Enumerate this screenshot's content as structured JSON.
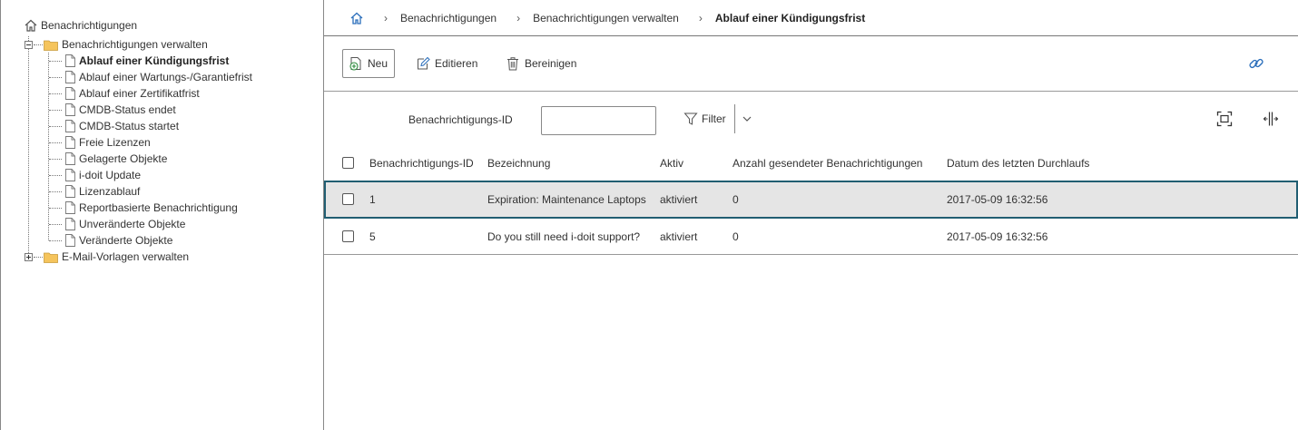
{
  "tree": {
    "root_label": "Benachrichtigungen",
    "group1_label": "Benachrichtigungen verwalten",
    "items": [
      "Ablauf einer Kündigungsfrist",
      "Ablauf einer Wartungs-/Garantiefrist",
      "Ablauf einer Zertifikatfrist",
      "CMDB-Status endet",
      "CMDB-Status startet",
      "Freie Lizenzen",
      "Gelagerte Objekte",
      "i-doit Update",
      "Lizenzablauf",
      "Reportbasierte Benachrichtigung",
      "Unveränderte Objekte",
      "Veränderte Objekte"
    ],
    "selected_item": "Ablauf einer Kündigungsfrist",
    "group2_label": "E-Mail-Vorlagen verwalten"
  },
  "breadcrumb": {
    "items": [
      "Benachrichtigungen",
      "Benachrichtigungen verwalten",
      "Ablauf einer Kündigungsfrist"
    ]
  },
  "toolbar": {
    "new_label": "Neu",
    "edit_label": "Editieren",
    "clean_label": "Bereinigen"
  },
  "filter": {
    "field_label": "Benachrichtigungs-ID",
    "input_value": "",
    "button_label": "Filter"
  },
  "table": {
    "columns": [
      "Benachrichtigungs-ID",
      "Bezeichnung",
      "Aktiv",
      "Anzahl gesendeter Benachrichtigungen",
      "Datum des letzten Durchlaufs"
    ],
    "rows": [
      {
        "id": "1",
        "name": "Expiration: Maintenance Laptops",
        "active": "aktiviert",
        "count": "0",
        "last_run": "2017-05-09 16:32:56"
      },
      {
        "id": "5",
        "name": "Do you still need i-doit support?",
        "active": "aktiviert",
        "count": "0",
        "last_run": "2017-05-09 16:32:56"
      }
    ]
  },
  "colors": {
    "selected_row_border": "#215e72",
    "selected_row_bg": "#e5e5e5",
    "link_icon": "#2a6ebb",
    "folder": "#f5c45c"
  },
  "icons": {
    "home": "home-icon",
    "folder": "folder-icon",
    "document": "document-icon",
    "new": "add-document-icon",
    "edit": "edit-icon",
    "clean": "trash-icon",
    "link": "link-icon",
    "filter": "funnel-icon",
    "chevron": "chevron-down-icon",
    "fit": "fit-screen-icon",
    "columns": "column-resize-icon"
  }
}
